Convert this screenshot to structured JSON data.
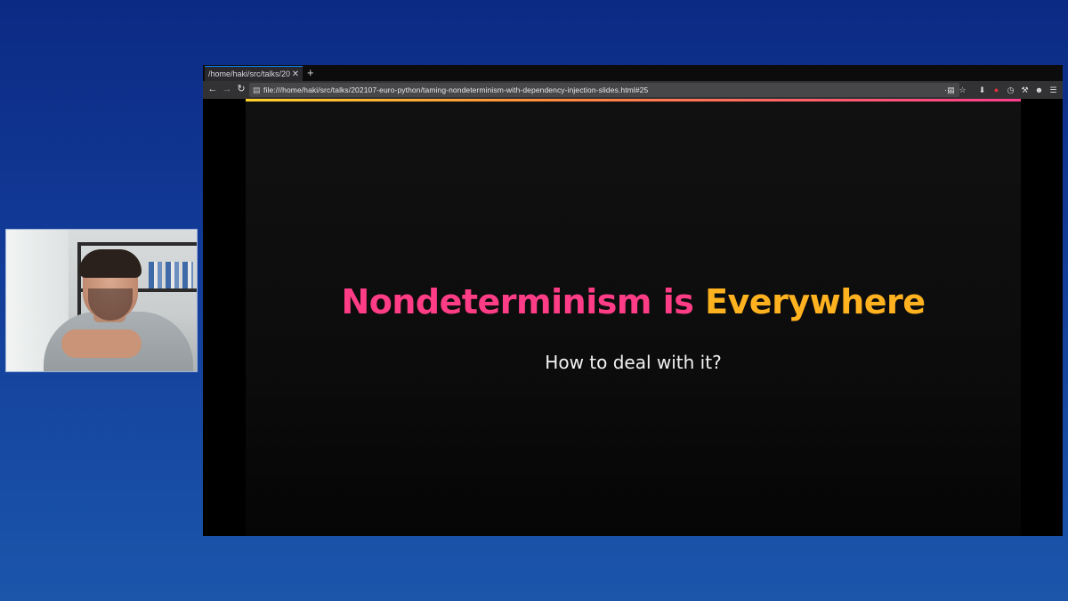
{
  "browser": {
    "tab": {
      "title": "/home/haki/src/talks/202…",
      "close_glyph": "✕"
    },
    "new_tab_glyph": "+",
    "nav": {
      "back": "←",
      "forward": "→",
      "reload": "↻"
    },
    "url": "file:///home/haki/src/talks/202107-euro-python/taming-nondeterminism-with-dependency-injection-slides.html#25",
    "toolbar_icons": [
      "reader-icon",
      "more-icon",
      "bookmark-star-icon",
      "download-icon",
      "extension-icon",
      "history-icon",
      "tools-icon",
      "account-icon",
      "menu-icon"
    ]
  },
  "slide": {
    "title_part1": "Nondeterminism is",
    "title_part2": "Everywhere",
    "subtitle": "How to deal with it?",
    "colors": {
      "pink": "#ff3d86",
      "orange": "#ffb21f",
      "bar_start": "#ffd22b",
      "bar_end": "#ff3d8e"
    }
  }
}
